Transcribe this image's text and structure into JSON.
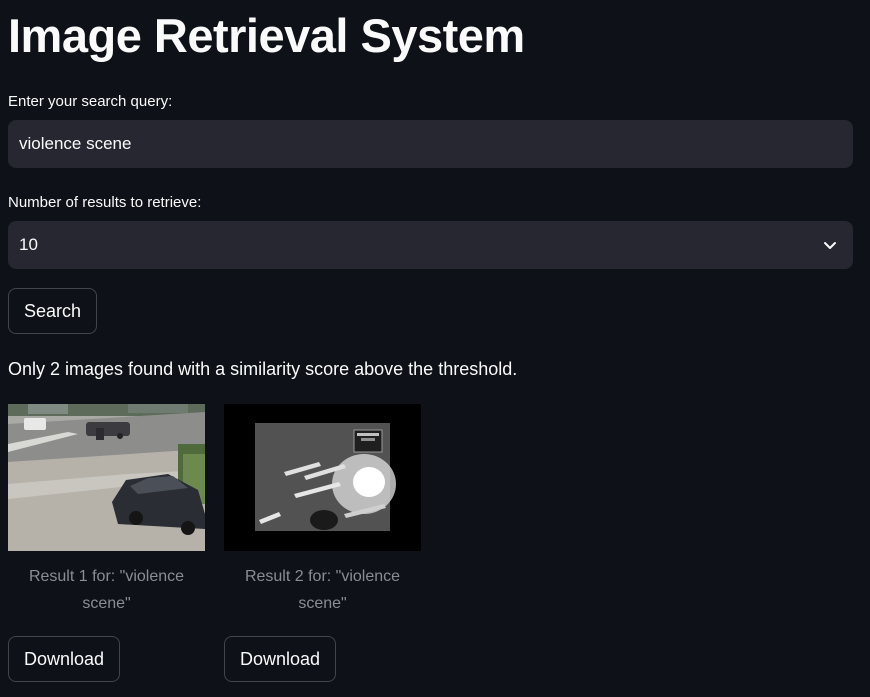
{
  "app": {
    "title": "Image Retrieval System"
  },
  "query": {
    "label": "Enter your search query:",
    "value": "violence scene"
  },
  "num_results": {
    "label": "Number of results to retrieve:",
    "selected": "10"
  },
  "search_button": {
    "label": "Search"
  },
  "status_message": "Only 2 images found with a similarity score above the threshold.",
  "results": [
    {
      "caption": "Result 1 for: \"violence scene\"",
      "download_label": "Download",
      "image": "cctv-street-car-photo"
    },
    {
      "caption": "Result 2 for: \"violence scene\"",
      "download_label": "Download",
      "image": "night-surveillance-road-photo"
    }
  ],
  "colors": {
    "background": "#0e1117",
    "input_bg": "#262730",
    "text": "#fafafa",
    "caption": "#8b8d94"
  }
}
